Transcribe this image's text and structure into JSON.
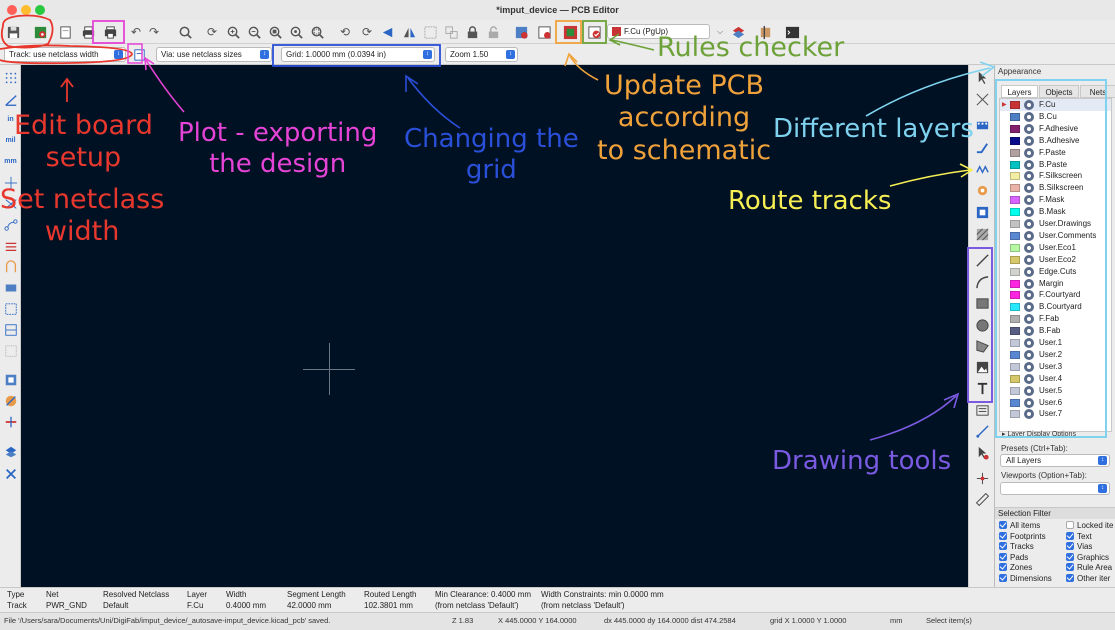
{
  "window": {
    "title": "*imput_device — PCB Editor"
  },
  "toolbar": {
    "layer_select": "F.Cu (PgUp)",
    "layer_color": "#c83434"
  },
  "toolbar2": {
    "track": "Track: use netclass width",
    "via": "Via: use netclass sizes",
    "grid": "Grid: 1.0000 mm (0.0394 in)",
    "zoom": "Zoom 1.50"
  },
  "appearance": {
    "title": "Appearance",
    "tabs": [
      "Layers",
      "Objects",
      "Nets"
    ],
    "layers": [
      {
        "name": "F.Cu",
        "color": "#c83434"
      },
      {
        "name": "B.Cu",
        "color": "#4d7fc4"
      },
      {
        "name": "F.Adhesive",
        "color": "#84216e"
      },
      {
        "name": "B.Adhesive",
        "color": "#0a0d8a"
      },
      {
        "name": "F.Paste",
        "color": "#b0a0a0"
      },
      {
        "name": "B.Paste",
        "color": "#00c2c2"
      },
      {
        "name": "F.Silkscreen",
        "color": "#f2eda1"
      },
      {
        "name": "B.Silkscreen",
        "color": "#e8b2a7"
      },
      {
        "name": "F.Mask",
        "color": "#d864ff"
      },
      {
        "name": "B.Mask",
        "color": "#02ffee"
      },
      {
        "name": "User.Drawings",
        "color": "#c2c2c2"
      },
      {
        "name": "User.Comments",
        "color": "#5987d1"
      },
      {
        "name": "User.Eco1",
        "color": "#b5f7a2"
      },
      {
        "name": "User.Eco2",
        "color": "#d6c768"
      },
      {
        "name": "Edge.Cuts",
        "color": "#d0d2cd"
      },
      {
        "name": "Margin",
        "color": "#ff26e2"
      },
      {
        "name": "F.Courtyard",
        "color": "#ff26e2"
      },
      {
        "name": "B.Courtyard",
        "color": "#26e9ff"
      },
      {
        "name": "F.Fab",
        "color": "#afafaf"
      },
      {
        "name": "B.Fab",
        "color": "#585d84"
      },
      {
        "name": "User.1",
        "color": "#c2c8d8"
      },
      {
        "name": "User.2",
        "color": "#5987d1"
      },
      {
        "name": "User.3",
        "color": "#c2c8d8"
      },
      {
        "name": "User.4",
        "color": "#d6c768"
      },
      {
        "name": "User.5",
        "color": "#c2c8d8"
      },
      {
        "name": "User.6",
        "color": "#5987d1"
      },
      {
        "name": "User.7",
        "color": "#c2c8d8"
      }
    ],
    "layer_display_options": "Layer Display Options",
    "presets_label": "Presets (Ctrl+Tab):",
    "presets_value": "All Layers",
    "viewports_label": "Viewports (Option+Tab):",
    "viewports_value": ""
  },
  "selection_filter": {
    "title": "Selection Filter",
    "left": [
      {
        "label": "All items",
        "checked": true
      },
      {
        "label": "Footprints",
        "checked": true
      },
      {
        "label": "Tracks",
        "checked": true
      },
      {
        "label": "Pads",
        "checked": true
      },
      {
        "label": "Zones",
        "checked": true
      },
      {
        "label": "Dimensions",
        "checked": true
      }
    ],
    "right": [
      {
        "label": "Locked ite",
        "checked": false
      },
      {
        "label": "Text",
        "checked": true
      },
      {
        "label": "Vias",
        "checked": true
      },
      {
        "label": "Graphics",
        "checked": true
      },
      {
        "label": "Rule Area",
        "checked": true
      },
      {
        "label": "Other iter",
        "checked": true
      }
    ]
  },
  "message_panel": [
    {
      "head": "Type",
      "value": "Track"
    },
    {
      "head": "Net",
      "value": "PWR_GND"
    },
    {
      "head": "Resolved Netclass",
      "value": "Default"
    },
    {
      "head": "Layer",
      "value": "F.Cu"
    },
    {
      "head": "Width",
      "value": "0.4000 mm"
    },
    {
      "head": "Segment Length",
      "value": "42.0000 mm"
    },
    {
      "head": "Routed Length",
      "value": "102.3801 mm"
    },
    {
      "head": "Min Clearance: 0.4000 mm",
      "value": "(from netclass 'Default')"
    },
    {
      "head": "Width Constraints: min 0.0000 mm",
      "value": "(from netclass 'Default')"
    }
  ],
  "status": {
    "file": "File '/Users/sara/Documents/Uni/DigiFab/imput_device/_autosave-imput_device.kicad_pcb' saved.",
    "zoom": "Z 1.83",
    "xy": "X 445.0000  Y 164.0000",
    "dxy": "dx 445.0000  dy 164.0000  dist 474.2584",
    "grid": "grid X 1.0000  Y 1.0000",
    "units": "mm",
    "mode": "Select item(s)"
  },
  "annotations": {
    "edit_board": "Edit board\nsetup",
    "netclass": "Set netclass\nwidth",
    "plot": "Plot - exporting\nthe design",
    "grid": "Changing the\ngrid",
    "update_pcb": "Update PCB\naccording\nto schematic",
    "rules": "Rules checker",
    "layers": "Different layers",
    "route": "Route tracks",
    "drawing": "Drawing tools",
    "colors": {
      "red": "#e8382e",
      "magenta": "#e544d6",
      "blue": "#2a4fd8",
      "orange": "#f0a23a",
      "green": "#6da23a",
      "cyan": "#7fd3ef",
      "yellow": "#f6ee52",
      "purple": "#7a5ae0"
    }
  }
}
